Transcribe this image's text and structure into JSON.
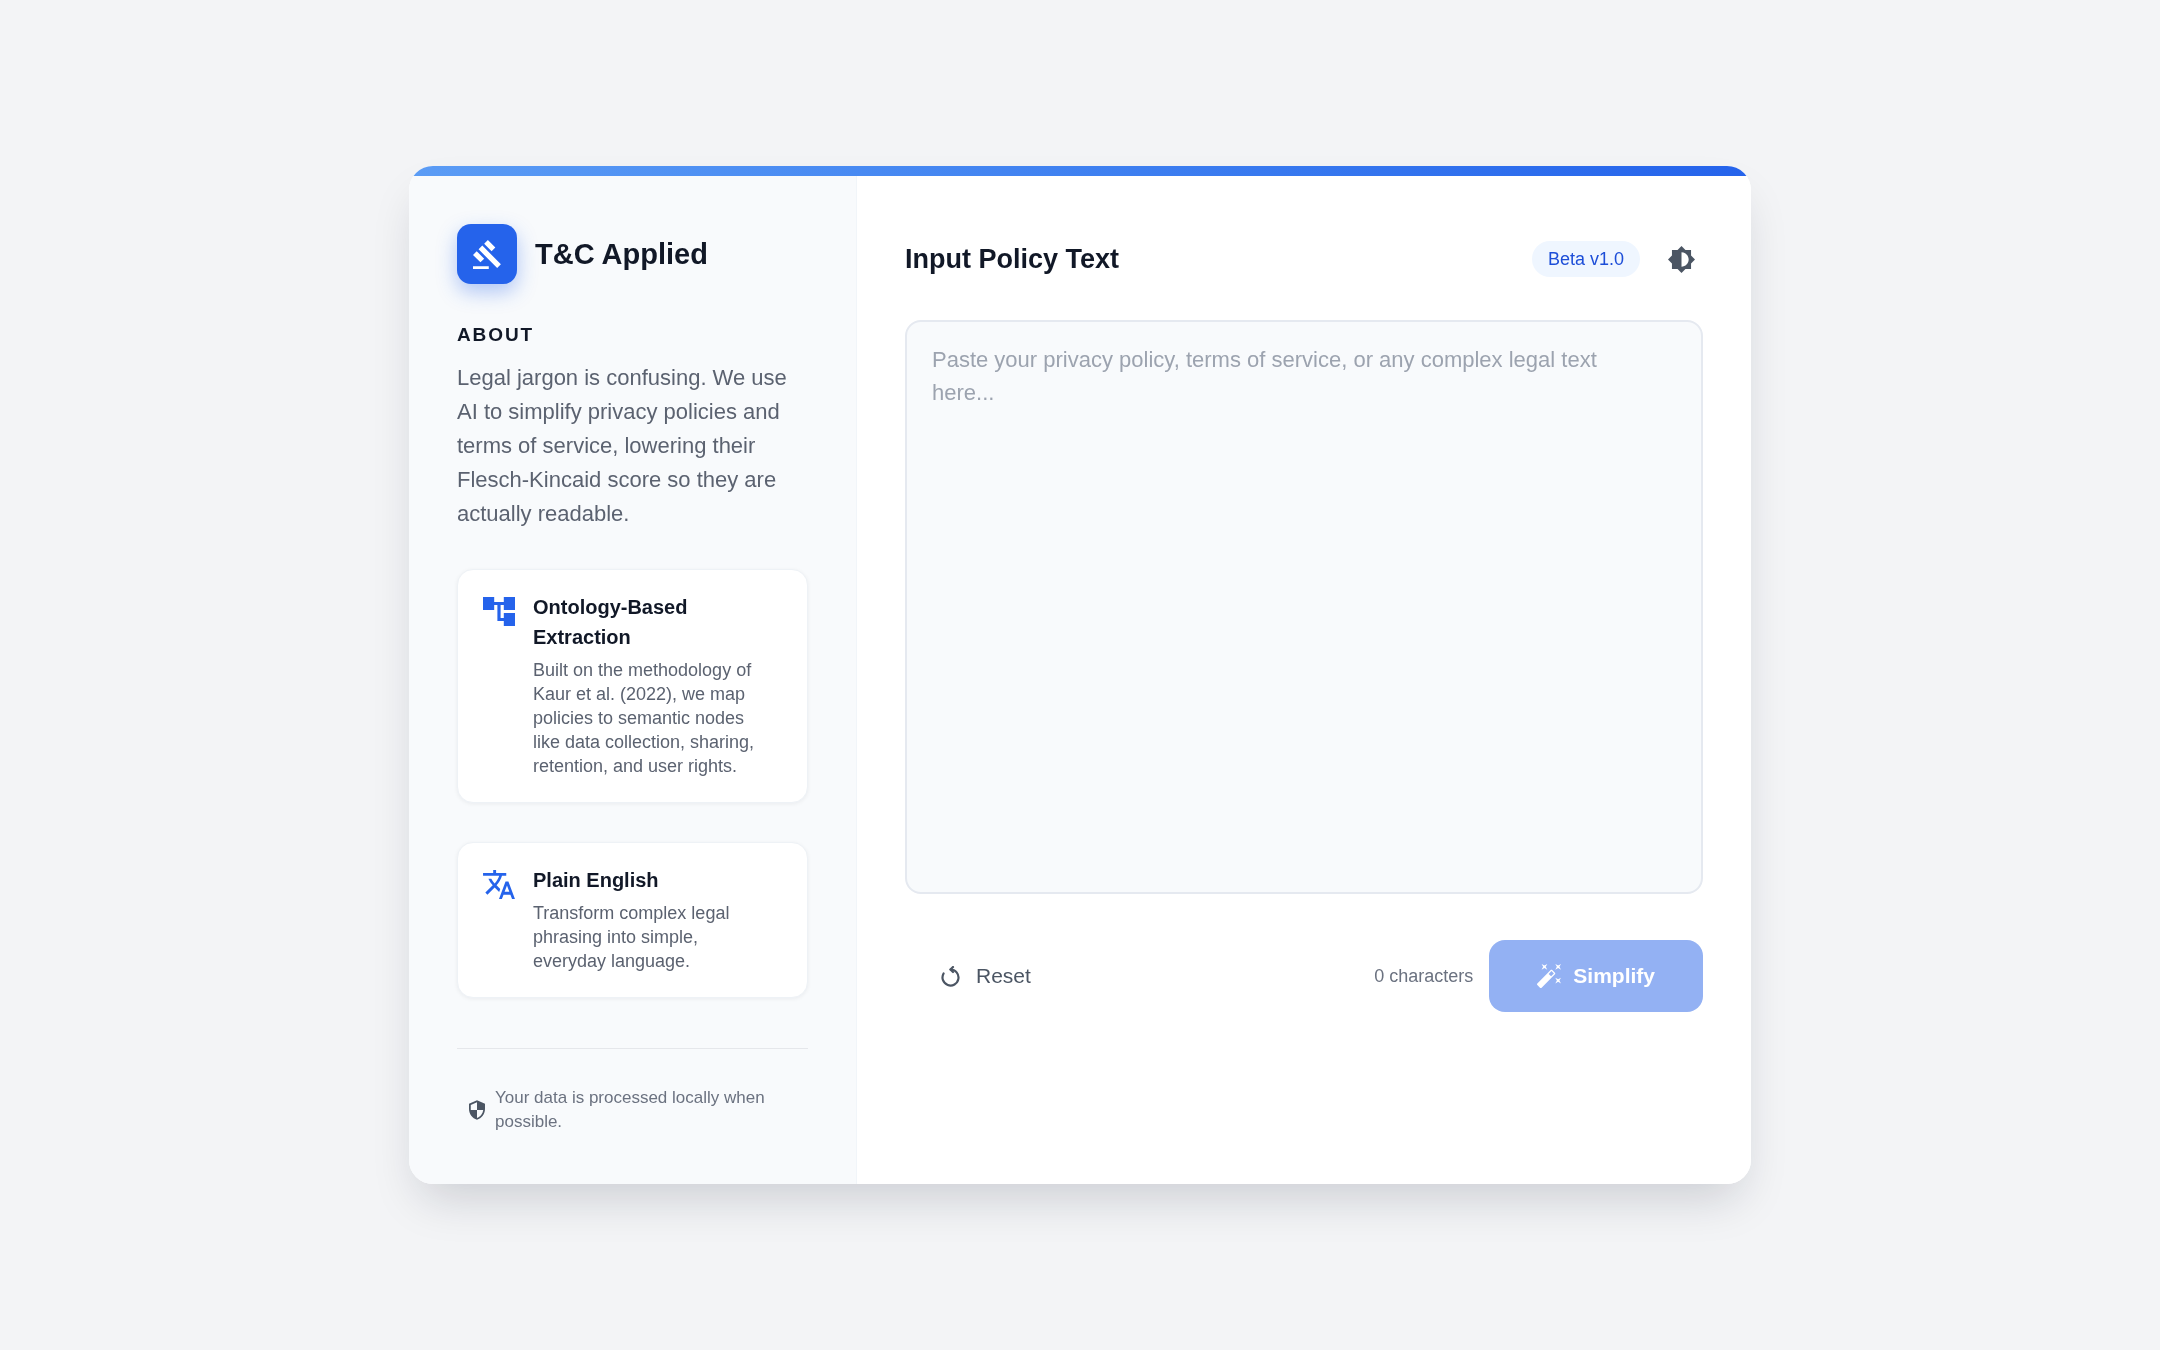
{
  "app": {
    "name": "T&C Applied"
  },
  "about": {
    "heading": "ABOUT",
    "text": "Legal jargon is confusing. We use AI to simplify privacy policies and terms of service, lowering their Flesch-Kincaid score so they are actually readable."
  },
  "features": [
    {
      "kind": "ontology",
      "title": "Ontology-Based Extraction",
      "description": "Built on the methodology of Kaur et al. (2022), we map policies to semantic nodes like data collection, sharing, retention, and user rights."
    },
    {
      "kind": "translate",
      "title": "Plain English",
      "description": "Transform complex legal phrasing into simple, everyday language."
    }
  ],
  "privacy_note": "Your data is processed locally when possible.",
  "main": {
    "title": "Input Policy Text",
    "badge": "Beta v1.0",
    "input": {
      "placeholder": "Paste your privacy policy, terms of service, or any complex legal text here..."
    },
    "reset_button": "Reset",
    "character_count": "0 characters",
    "simplify_button": {
      "label": "Simplify",
      "disabled": true
    }
  }
}
